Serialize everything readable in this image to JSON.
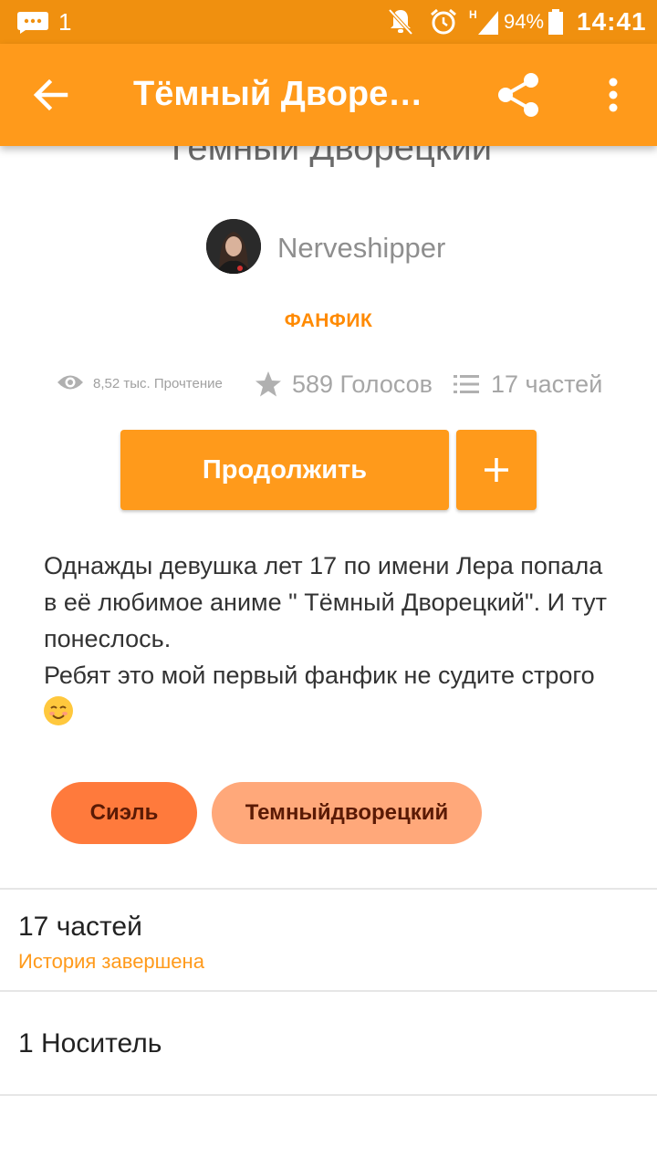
{
  "status_bar": {
    "notification_count": "1",
    "battery": "94%",
    "time": "14:41",
    "network": "H",
    "icons": [
      "message-icon",
      "notifications-off-icon",
      "alarm-icon",
      "signal-icon",
      "battery-icon"
    ]
  },
  "app_bar": {
    "title": "Тёмный Дворецкий",
    "icons": [
      "back-arrow-icon",
      "share-icon",
      "more-vert-icon"
    ]
  },
  "story": {
    "title": "Тёмный Дворецкий",
    "author": "Nerveshipper",
    "category": "ФАНФИК",
    "stats": {
      "reads": "8,52 тыс. Прочтение",
      "votes": "589 Голосов",
      "parts": "17 частей"
    },
    "continue_label": "Продолжить",
    "add_label": "+",
    "description_lines": [
      "Однажды девушка лет 17 по имени Лера попала в её любимое аниме \" Тёмный Дворецкий\".  И тут понеслось.",
      "Ребят это мой первый фанфик не судите строго"
    ],
    "tags": [
      "Сиэль",
      "Темныйдворецкий"
    ]
  },
  "parts_section": {
    "title": "17 частей",
    "status": "История завершена"
  },
  "medium_section": {
    "title": "1 Носитель"
  },
  "colors": {
    "status_bar": "#f0900f",
    "accent": "#ff9a1b",
    "tag_primary": "#ff7a3c",
    "tag_secondary": "#ffa87a"
  }
}
